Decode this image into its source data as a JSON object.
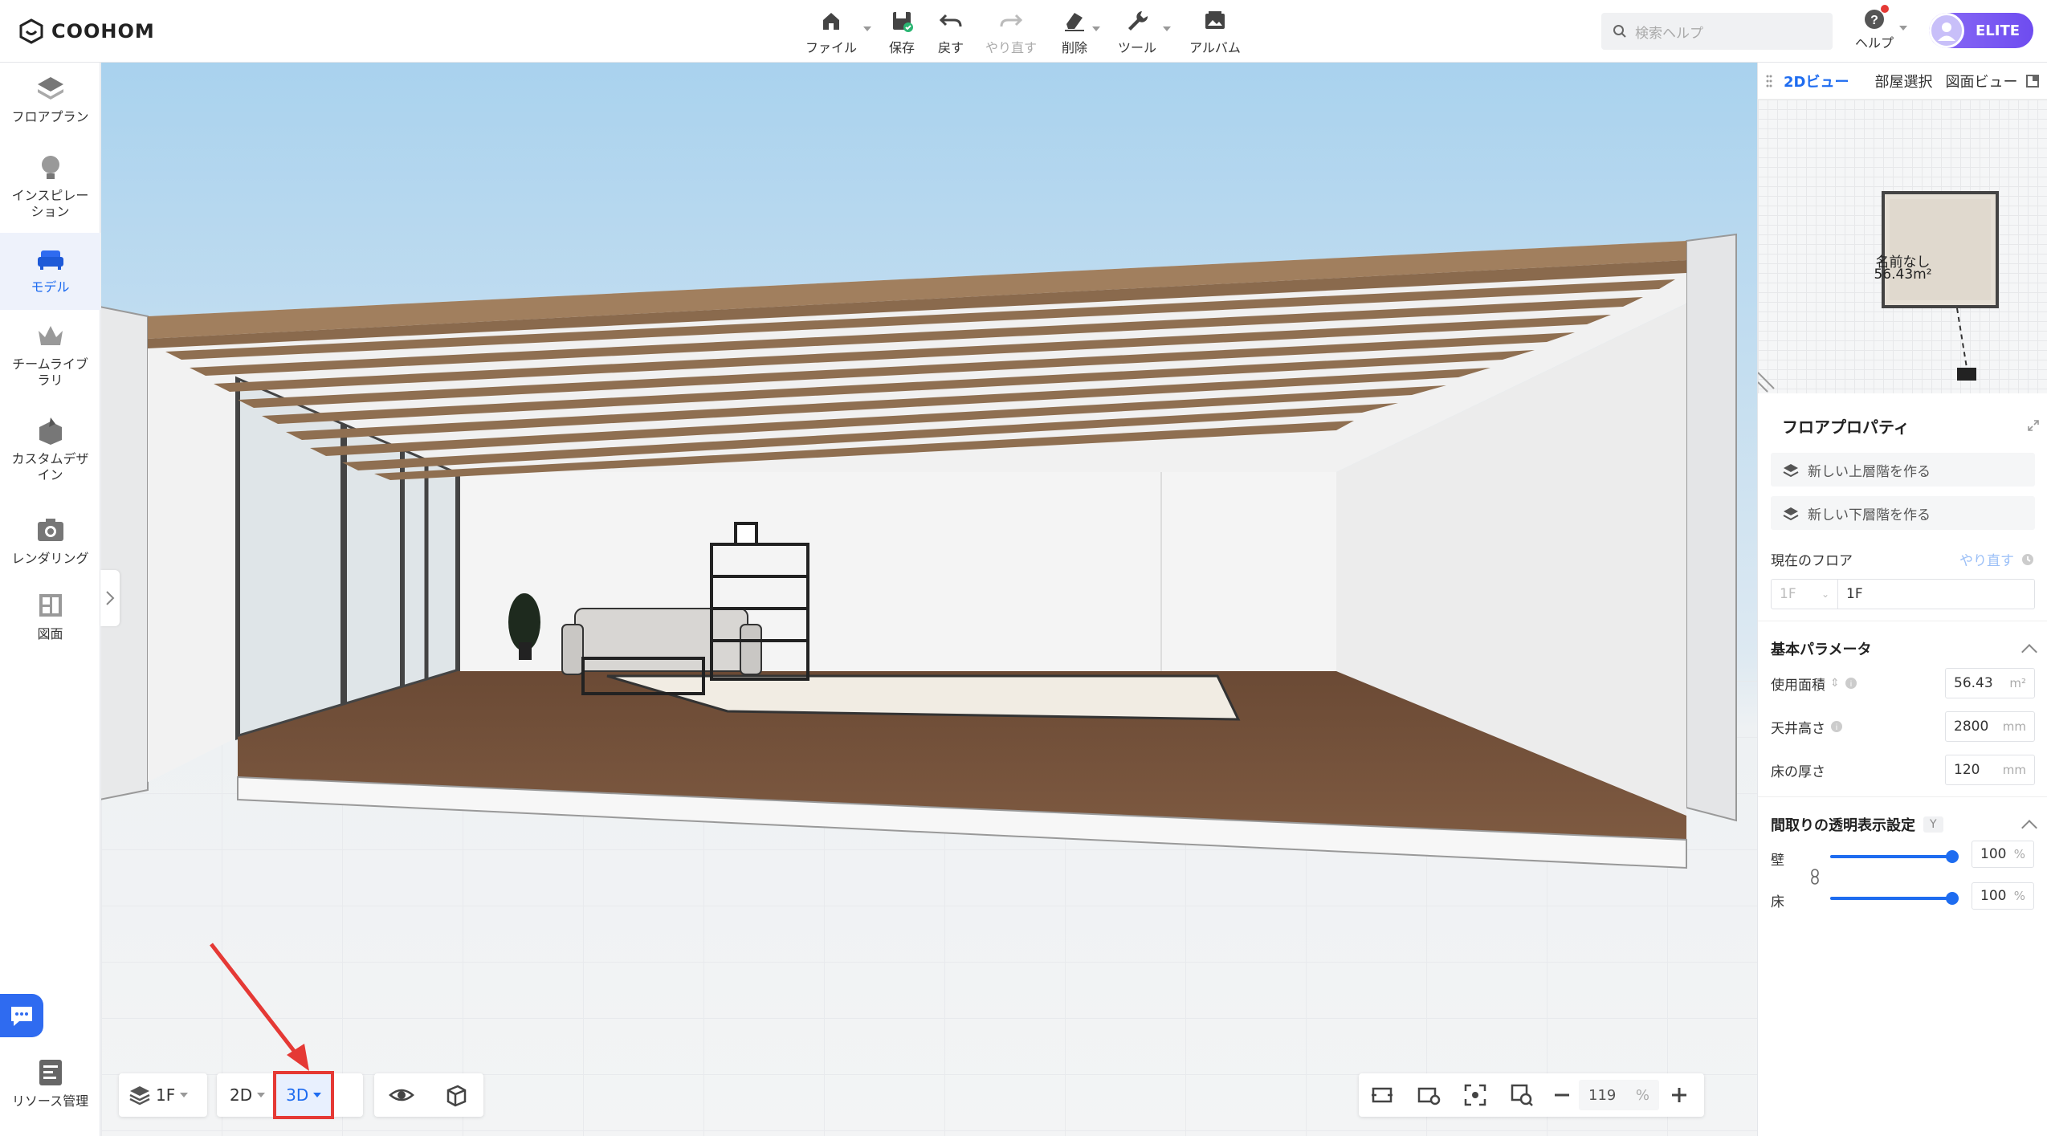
{
  "app": {
    "logo_text": "COOHOM"
  },
  "toolbar": {
    "file": "ファイル",
    "save": "保存",
    "undo": "戻す",
    "redo": "やり直す",
    "delete": "削除",
    "tools": "ツール",
    "album": "アルバム"
  },
  "search": {
    "placeholder": "検索ヘルプ"
  },
  "help": {
    "label": "ヘルプ"
  },
  "account": {
    "badge": "ELITE"
  },
  "sidebar": {
    "items": [
      {
        "label": "フロアプラン"
      },
      {
        "label": "インスピレーション"
      },
      {
        "label": "モデル"
      },
      {
        "label": "チームライブラリ"
      },
      {
        "label": "カスタムデザイン"
      },
      {
        "label": "レンダリング"
      },
      {
        "label": "図面"
      }
    ],
    "resource_label": "リソース管理"
  },
  "bottom": {
    "floor": "1F",
    "view2d": "2D",
    "view3d": "3D",
    "zoom_value": "119",
    "zoom_unit": "%"
  },
  "right": {
    "tabs": [
      "2Dビュー",
      "部屋選択",
      "図面ビュー"
    ],
    "minimap": {
      "room_name": "名前なし",
      "room_area": "56.43m²"
    },
    "floor_props": {
      "title": "フロアプロパティ",
      "new_upper": "新しい上層階を作る",
      "new_lower": "新しい下層階を作る",
      "current_floor_label": "現在のフロア",
      "redo_link": "やり直す",
      "floor_select": "1F",
      "floor_name": "1F",
      "basic_params": "基本パラメータ",
      "usable_area_label": "使用面積",
      "usable_area_value": "56.43",
      "usable_area_unit": "m²",
      "ceiling_label": "天井高さ",
      "ceiling_value": "2800",
      "ceiling_unit": "mm",
      "floor_thick_label": "床の厚さ",
      "floor_thick_value": "120",
      "floor_thick_unit": "mm",
      "transparency_title": "間取りの透明表示設定",
      "transparency_key": "Y",
      "wall_label": "壁",
      "wall_value": "100",
      "floor_label": "床",
      "floor_value": "100",
      "pct": "%"
    }
  },
  "colors": {
    "accent": "#1e6cf0",
    "highlight": "#e53935",
    "elite": "#7c5cf2"
  }
}
